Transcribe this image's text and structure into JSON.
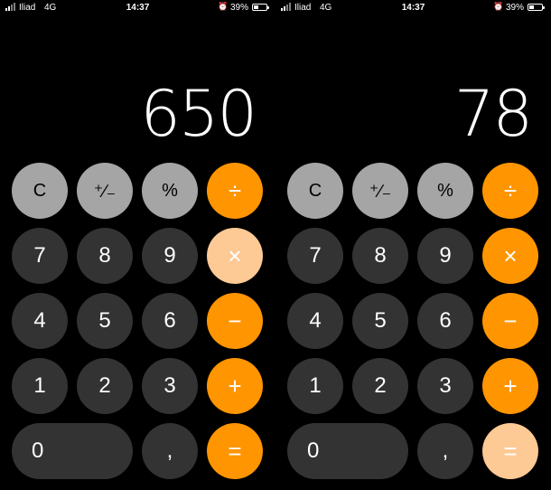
{
  "screens": [
    {
      "status": {
        "carrier": "Iliad",
        "network": "4G",
        "time": "14:37",
        "alarm_icon": "alarm-clock-icon",
        "battery": "39%",
        "battery_level": 0.39
      },
      "display": "650",
      "active_operator": "multiply",
      "keys": {
        "clear": "C",
        "sign": "⁺∕₋",
        "percent": "%",
        "divide": "÷",
        "seven": "7",
        "eight": "8",
        "nine": "9",
        "multiply": "×",
        "four": "4",
        "five": "5",
        "six": "6",
        "minus": "−",
        "one": "1",
        "two": "2",
        "three": "3",
        "plus": "+",
        "zero": "0",
        "decimal": ",",
        "equals": "="
      }
    },
    {
      "status": {
        "carrier": "Iliad",
        "network": "4G",
        "time": "14:37",
        "alarm_icon": "alarm-clock-icon",
        "battery": "39%",
        "battery_level": 0.39
      },
      "display": "78",
      "active_operator": "equals",
      "keys": {
        "clear": "C",
        "sign": "⁺∕₋",
        "percent": "%",
        "divide": "÷",
        "seven": "7",
        "eight": "8",
        "nine": "9",
        "multiply": "×",
        "four": "4",
        "five": "5",
        "six": "6",
        "minus": "−",
        "one": "1",
        "two": "2",
        "three": "3",
        "plus": "+",
        "zero": "0",
        "decimal": ",",
        "equals": "="
      }
    }
  ],
  "colors": {
    "background": "#000000",
    "digit_key": "#333333",
    "function_key": "#a5a5a5",
    "operator_key": "#ff9500",
    "operator_key_highlighted": "#fdc994"
  }
}
